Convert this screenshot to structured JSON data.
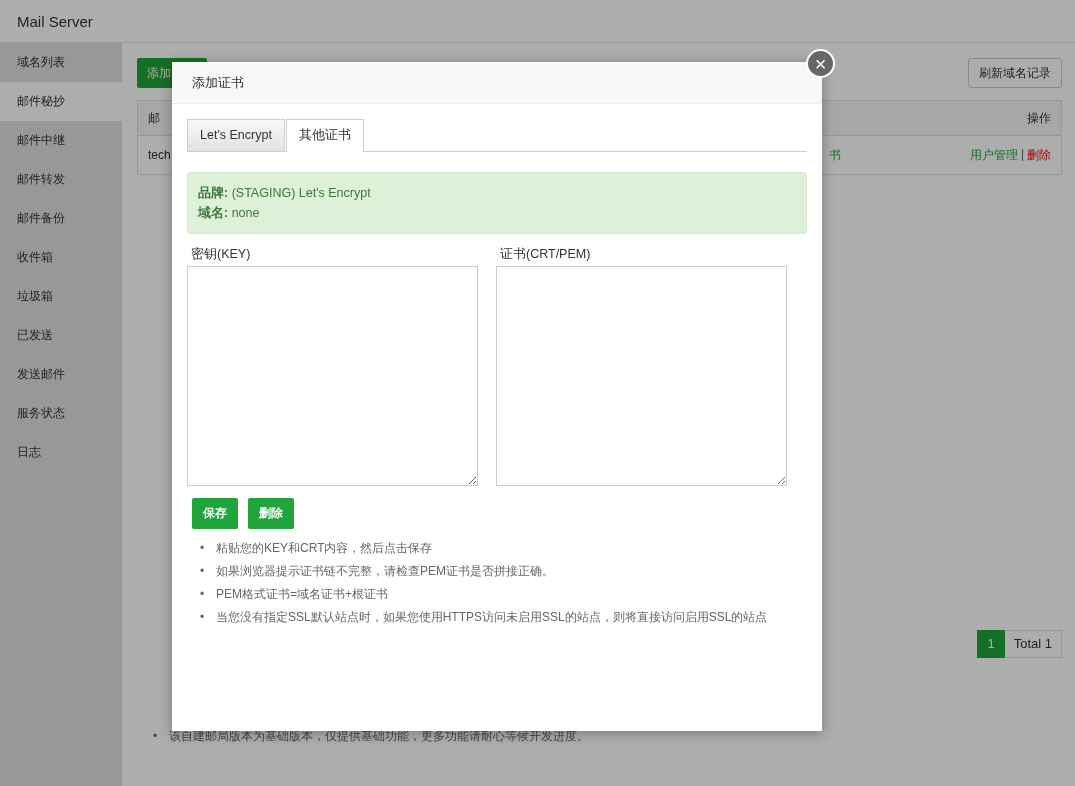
{
  "window": {
    "title": "Mail Server"
  },
  "sidebar": {
    "items": [
      {
        "label": "域名列表",
        "selected": false
      },
      {
        "label": "邮件秘抄",
        "selected": true
      },
      {
        "label": "邮件中继",
        "selected": false
      },
      {
        "label": "邮件转发",
        "selected": false
      },
      {
        "label": "邮件备份",
        "selected": false
      },
      {
        "label": "收件箱",
        "selected": false
      },
      {
        "label": "垃圾箱",
        "selected": false
      },
      {
        "label": "已发送",
        "selected": false
      },
      {
        "label": "发送邮件",
        "selected": false
      },
      {
        "label": "服务状态",
        "selected": false
      },
      {
        "label": "日志",
        "selected": false
      }
    ]
  },
  "toolbar": {
    "add_button": "添加",
    "refresh_button": "刷新域名记录"
  },
  "table": {
    "columns": [
      "邮",
      "操作"
    ],
    "rows": [
      {
        "cell_1": "tech",
        "cell_cert": "书",
        "actions": [
          "用户管理",
          "删除"
        ],
        "separator": "|"
      }
    ]
  },
  "pagination": {
    "pages": [
      {
        "label": "1",
        "selected": true
      }
    ],
    "total": "Total 1"
  },
  "notes": {
    "bullet": "•",
    "items": [
      "该自建邮局版本为基础版本，仅提供基础功能，更多功能请耐心等候开发进度。"
    ]
  },
  "dialog": {
    "title": "添加证书",
    "close": "×",
    "tabs": [
      {
        "label": "Let's Encrypt",
        "selected": false
      },
      {
        "label": "其他证书",
        "selected": true
      }
    ],
    "info": [
      {
        "label": "品牌:",
        "value": "(STAGING) Let's Encrypt"
      },
      {
        "label": "域名:",
        "value": "none"
      }
    ],
    "fields": [
      {
        "label": "密钥(KEY)"
      },
      {
        "label": "证书(CRT/PEM)"
      }
    ],
    "buttons": [
      "保存",
      "删除"
    ],
    "bullet": "•",
    "tips": [
      "粘贴您的KEY和CRT内容，然后点击保存",
      "如果浏览器提示证书链不完整，请检查PEM证书是否拼接正确。",
      "PEM格式证书=域名证书+根证书",
      "当您没有指定SSL默认站点时，如果您使用HTTPS访问未启用SSL的站点，则将直接访问启用SSL的站点"
    ]
  }
}
